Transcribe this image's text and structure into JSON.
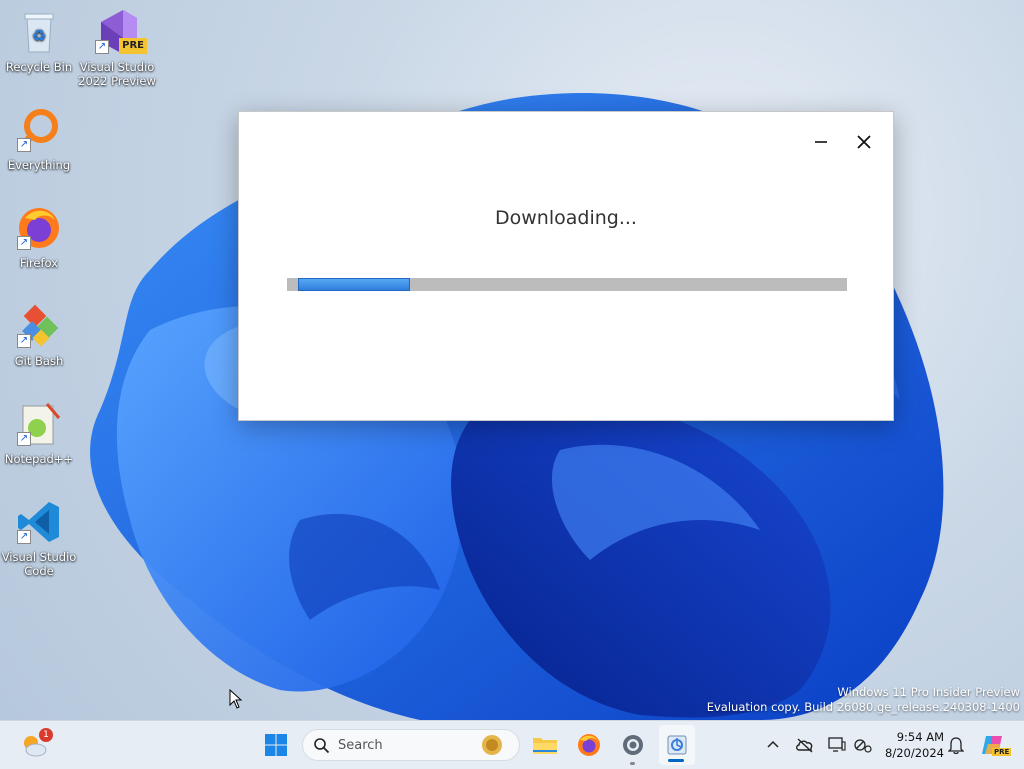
{
  "desktop": {
    "icons": [
      {
        "label": "Recycle Bin",
        "icon": "recycle-bin-icon"
      },
      {
        "label": "Visual Studio 2022 Preview",
        "icon": "visual-studio-icon",
        "badge": "PRE"
      },
      {
        "label": "Everything",
        "icon": "everything-search-icon"
      },
      {
        "label": "Firefox",
        "icon": "firefox-icon"
      },
      {
        "label": "Git Bash",
        "icon": "git-bash-icon"
      },
      {
        "label": "Notepad++",
        "icon": "notepad-plus-plus-icon"
      },
      {
        "label": "Visual Studio Code",
        "icon": "vscode-icon"
      }
    ],
    "shortcut_arrow": "↗",
    "watermark": {
      "line1": "Windows 11 Pro Insider Preview",
      "line2": "Evaluation copy. Build 26080.ge_release.240308-1400"
    }
  },
  "dialog": {
    "status": "Downloading...",
    "progress": 0.2,
    "colors": {
      "progress_fill": "#3b8de6",
      "progress_track": "#bcbcbc"
    }
  },
  "taskbar": {
    "weather_badge": "1",
    "search_placeholder": "Search",
    "apps": [
      "start-icon",
      "file-explorer-icon",
      "firefox-icon",
      "settings-icon",
      "installer-icon"
    ],
    "tray_icons": [
      "chevron-up-icon",
      "onedrive-offline-icon",
      "display-icon",
      "network-icon"
    ],
    "time": "9:54 AM",
    "date": "8/20/2024",
    "copilot_badge": "PRE",
    "accent": "#0067c0"
  }
}
